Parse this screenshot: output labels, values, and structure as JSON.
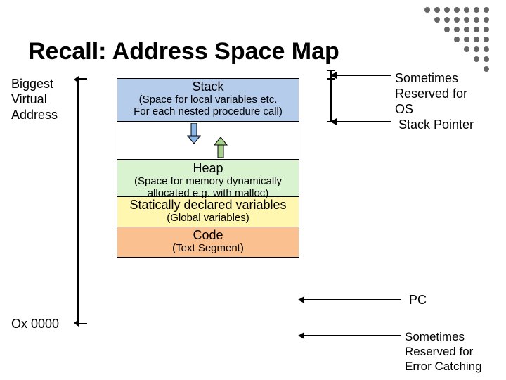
{
  "title": "Recall: Address Space Map",
  "left": {
    "top": "Biggest\nVirtual\nAddress",
    "bottom": "Ox 0000"
  },
  "right": {
    "top": "Sometimes\nReserved for\nOS\n Stack Pointer",
    "pc": "PC",
    "bottom": "Sometimes\nReserved for\nError Catching"
  },
  "boxes": {
    "stack": {
      "title": "Stack",
      "sub": "(Space for local variables etc.\nFor each nested procedure call)"
    },
    "heap": {
      "title": "Heap",
      "sub": "(Space for memory dynamically\nallocated e.g. with malloc)"
    },
    "static": {
      "title": "Statically declared variables",
      "sub": "(Global variables)"
    },
    "code": {
      "title": "Code",
      "sub": "(Text Segment)"
    }
  }
}
